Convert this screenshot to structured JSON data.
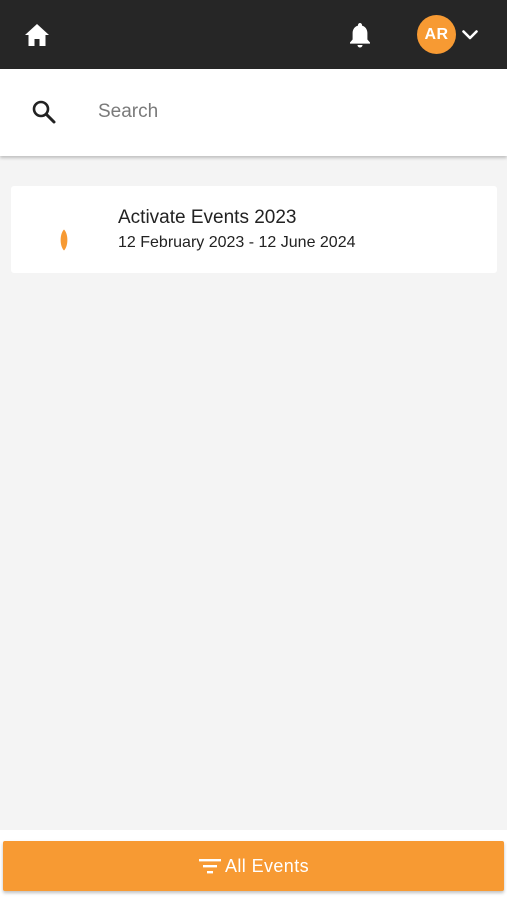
{
  "theme": {
    "accent": "#f79a33",
    "topbar_bg": "#262626",
    "page_bg": "#f4f4f4"
  },
  "header": {
    "home_icon": "home-icon",
    "notifications_icon": "bell-icon",
    "user_initials": "AR",
    "menu_icon": "chevron-down-icon"
  },
  "search": {
    "icon": "search-icon",
    "placeholder": "Search",
    "value": ""
  },
  "events": [
    {
      "title": "Activate Events 2023",
      "dates": "12 February 2023 - 12 June 2024",
      "icon": "leaf-icon"
    }
  ],
  "footer": {
    "filter_icon": "filter-icon",
    "filter_label": "All Events"
  }
}
